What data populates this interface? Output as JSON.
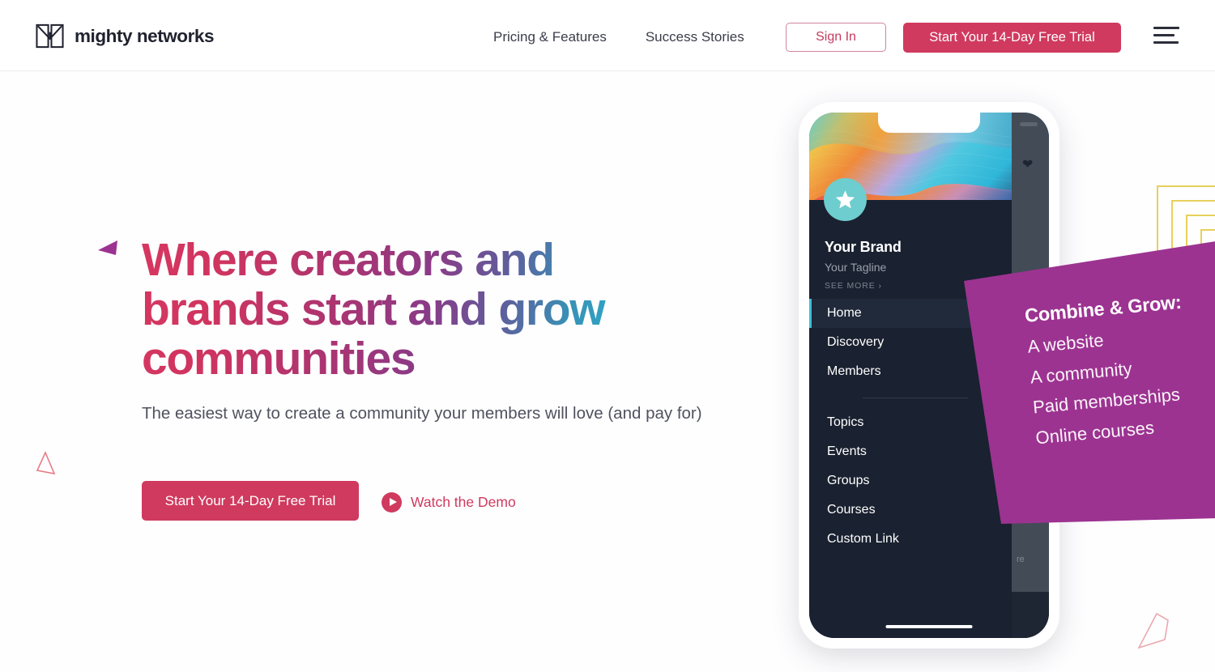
{
  "header": {
    "logo_text": "mighty networks",
    "logo_icon": "mighty-m-logo-icon",
    "nav": [
      {
        "label": "Pricing & Features"
      },
      {
        "label": "Success Stories"
      }
    ],
    "sign_in_label": "Sign In",
    "trial_label": "Start Your 14-Day Free Trial",
    "menu_icon": "hamburger-menu-icon"
  },
  "hero": {
    "headline": "Where creators and brands start and grow communities",
    "subhead": "The easiest way to create a community your members will love (and pay for)",
    "trial_label": "Start Your 14-Day Free Trial",
    "watch_demo_label": "Watch the Demo",
    "play_icon": "play-circle-icon"
  },
  "phone": {
    "brand_name": "Your Brand",
    "brand_tagline": "Your Tagline",
    "see_more": "SEE MORE ›",
    "avatar_icon": "star-icon",
    "heart_icon": "heart-icon",
    "panel_text": "re",
    "nav_primary": [
      {
        "label": "Home",
        "active": true
      },
      {
        "label": "Discovery",
        "active": false
      },
      {
        "label": "Members",
        "active": false
      }
    ],
    "nav_secondary": [
      {
        "label": "Topics"
      },
      {
        "label": "Events"
      },
      {
        "label": "Groups"
      },
      {
        "label": "Courses"
      },
      {
        "label": "Custom Link"
      }
    ]
  },
  "callout": {
    "title": "Combine & Grow:",
    "lines": [
      "A website",
      "A community",
      "Paid memberships",
      "Online courses"
    ]
  },
  "decor": {
    "triangle_purple": "triangle-purple-icon",
    "triangle_pink": "triangle-outline-pink-icon",
    "polygon_pink": "polygon-outline-pink-icon",
    "squares_yellow": "nested-squares-yellow-icon"
  },
  "colors": {
    "brand_crimson": "#cf3a5e",
    "brand_magenta": "#9c3391",
    "brand_teal": "#23b4cd",
    "accent_yellow": "#e8d05a",
    "accent_pink_outline": "#e8a6ac",
    "drawer_bg": "#1a2130",
    "avatar_teal": "#6ecdce",
    "text_dark": "#20222f",
    "text_body": "#50525e"
  }
}
